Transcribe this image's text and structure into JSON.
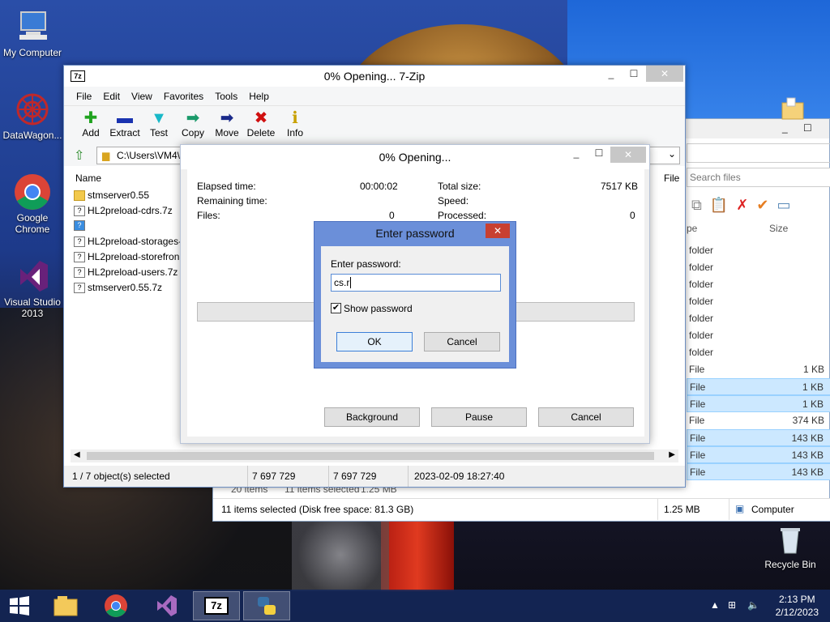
{
  "desktop": {
    "icons": [
      {
        "label": "My Computer"
      },
      {
        "label": "DataWagon..."
      },
      {
        "label": "Google Chrome"
      },
      {
        "label": "Visual Studio 2013"
      },
      {
        "label": "Recycle Bin"
      }
    ]
  },
  "explorer": {
    "search_placeholder": "Search files",
    "col_type_partial": "pe",
    "col_size": "Size",
    "rows": [
      {
        "type": "folder",
        "size": ""
      },
      {
        "type": "folder",
        "size": ""
      },
      {
        "type": "folder",
        "size": ""
      },
      {
        "type": "folder",
        "size": ""
      },
      {
        "type": "folder",
        "size": ""
      },
      {
        "type": "folder",
        "size": ""
      },
      {
        "type": "folder",
        "size": ""
      },
      {
        "type": "File",
        "size": "1 KB"
      },
      {
        "type": "File",
        "size": "1 KB"
      },
      {
        "type": "File",
        "size": "1 KB"
      },
      {
        "type": "File",
        "size": "374 KB"
      },
      {
        "type": "File",
        "size": "143 KB"
      },
      {
        "type": "File",
        "size": "143 KB"
      },
      {
        "type": "File",
        "size": "143 KB"
      }
    ],
    "status_items": "20 items",
    "status_selected": "11 items selected",
    "status_size": "1.25 MB",
    "status_bar_text": "11 items selected (Disk free space: 81.3 GB)",
    "status_bar_size": "1.25 MB",
    "status_bar_location": "Computer"
  },
  "zip": {
    "title": "0% Opening... 7-Zip",
    "logo": "7z",
    "menu": [
      "File",
      "Edit",
      "View",
      "Favorites",
      "Tools",
      "Help"
    ],
    "toolbar": [
      {
        "label": "Add",
        "icon": "plus-icon"
      },
      {
        "label": "Extract",
        "icon": "minus-icon"
      },
      {
        "label": "Test",
        "icon": "check-icon"
      },
      {
        "label": "Copy",
        "icon": "copy-arrow-icon"
      },
      {
        "label": "Move",
        "icon": "move-arrow-icon"
      },
      {
        "label": "Delete",
        "icon": "delete-x-icon"
      },
      {
        "label": "Info",
        "icon": "info-icon"
      }
    ],
    "address": "C:\\Users\\VM4\\",
    "col_name": "Name",
    "col_file": "File",
    "files": [
      {
        "name": "stmserver0.55",
        "kind": "folder"
      },
      {
        "name": "HL2preload-cdrs.7z",
        "kind": "archive"
      },
      {
        "name": "",
        "kind": "archive-blue"
      },
      {
        "name": "HL2preload-storages-",
        "kind": "archive"
      },
      {
        "name": "HL2preload-storefron",
        "kind": "archive"
      },
      {
        "name": "HL2preload-users.7z",
        "kind": "archive"
      },
      {
        "name": "stmserver0.55.7z",
        "kind": "archive"
      }
    ],
    "status": {
      "selected": "1 / 7 object(s) selected",
      "size1": "7 697 729",
      "size2": "7 697 729",
      "date": "2023-02-09 18:27:40"
    }
  },
  "progress": {
    "title": "0% Opening...",
    "elapsed_label": "Elapsed time:",
    "elapsed_value": "00:00:02",
    "remaining_label": "Remaining time:",
    "files_label": "Files:",
    "files_value": "0",
    "total_label": "Total size:",
    "total_value": "7517 KB",
    "speed_label": "Speed:",
    "processed_label": "Processed:",
    "processed_value": "0",
    "progress_fraction": 0,
    "btn_background": "Background",
    "btn_pause": "Pause",
    "btn_cancel": "Cancel"
  },
  "password": {
    "title": "Enter password",
    "label": "Enter password:",
    "value": "cs.r",
    "show_password_label": "Show password",
    "show_password_checked": true,
    "ok": "OK",
    "cancel": "Cancel"
  },
  "taskbar": {
    "time": "2:13 PM",
    "date": "2/12/2023",
    "apps": [
      "start-icon",
      "file-explorer-icon",
      "chrome-icon",
      "visual-studio-icon",
      "7zip-icon",
      "python-icon"
    ]
  }
}
